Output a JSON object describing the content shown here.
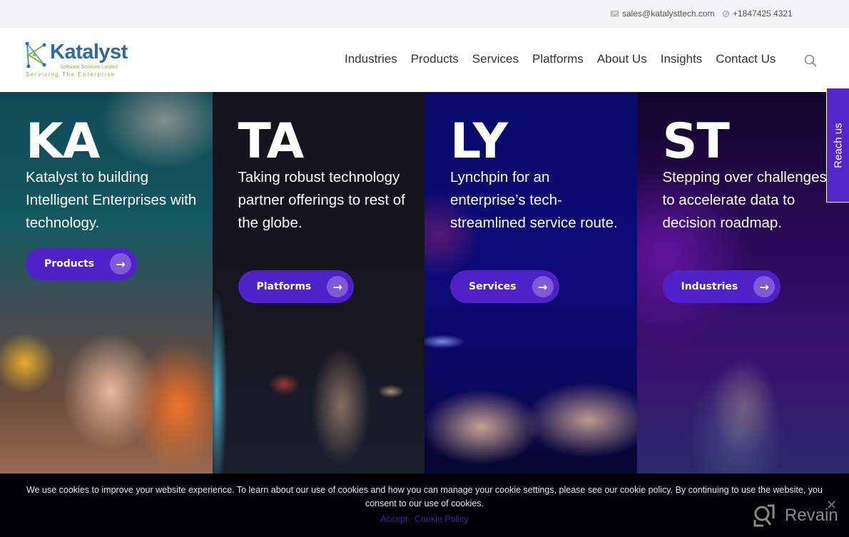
{
  "topbar": {
    "email": "sales@katalysttech.com",
    "email_icon": "mail-icon",
    "phone": "+1847425 4321",
    "phone_icon": "phone-icon"
  },
  "header": {
    "logo": {
      "name": "Katalyst",
      "subtitle": "Software Services Limited",
      "tagline": "Servicing The Enterprise"
    },
    "nav": [
      "Industries",
      "Products",
      "Services",
      "Platforms",
      "About Us",
      "Insights",
      "Contact Us"
    ],
    "search_icon": "search-icon"
  },
  "hero": {
    "panels": [
      {
        "letters": "KA",
        "description": "Katalyst to building Intelligent Enterprises with technology.",
        "button": "Products",
        "button_icon": "arrow-right-icon"
      },
      {
        "letters": "TA",
        "description": "Taking robust technology partner offerings to rest of the globe.",
        "button": "Platforms",
        "button_icon": "arrow-right-icon"
      },
      {
        "letters": "LY",
        "description": "Lynchpin for an enterprise’s tech-streamlined service route.",
        "button": "Services",
        "button_icon": "arrow-right-icon"
      },
      {
        "letters": "ST",
        "description": "Stepping over challenges to accelerate data to decision roadmap.",
        "button": "Industries",
        "button_icon": "arrow-right-icon"
      }
    ]
  },
  "reach_us": "Reach us",
  "cookie_banner": {
    "message": "We use cookies to improve your website experience. To learn about our use of cookies and how you can manage your cookie settings, please see our cookie policy. By continuing to use the website, you consent to our use of cookies.",
    "accept": "Accept",
    "policy": "Cookie Policy",
    "close": "✕"
  },
  "watermark": {
    "text": "Revain"
  },
  "colors": {
    "accent": "#4f21c9",
    "reach_us_bg": "#5227c9",
    "logo_blue": "#2b6aa6",
    "logo_green": "#8cb53f",
    "cookie_link": "#3f1fb0"
  }
}
